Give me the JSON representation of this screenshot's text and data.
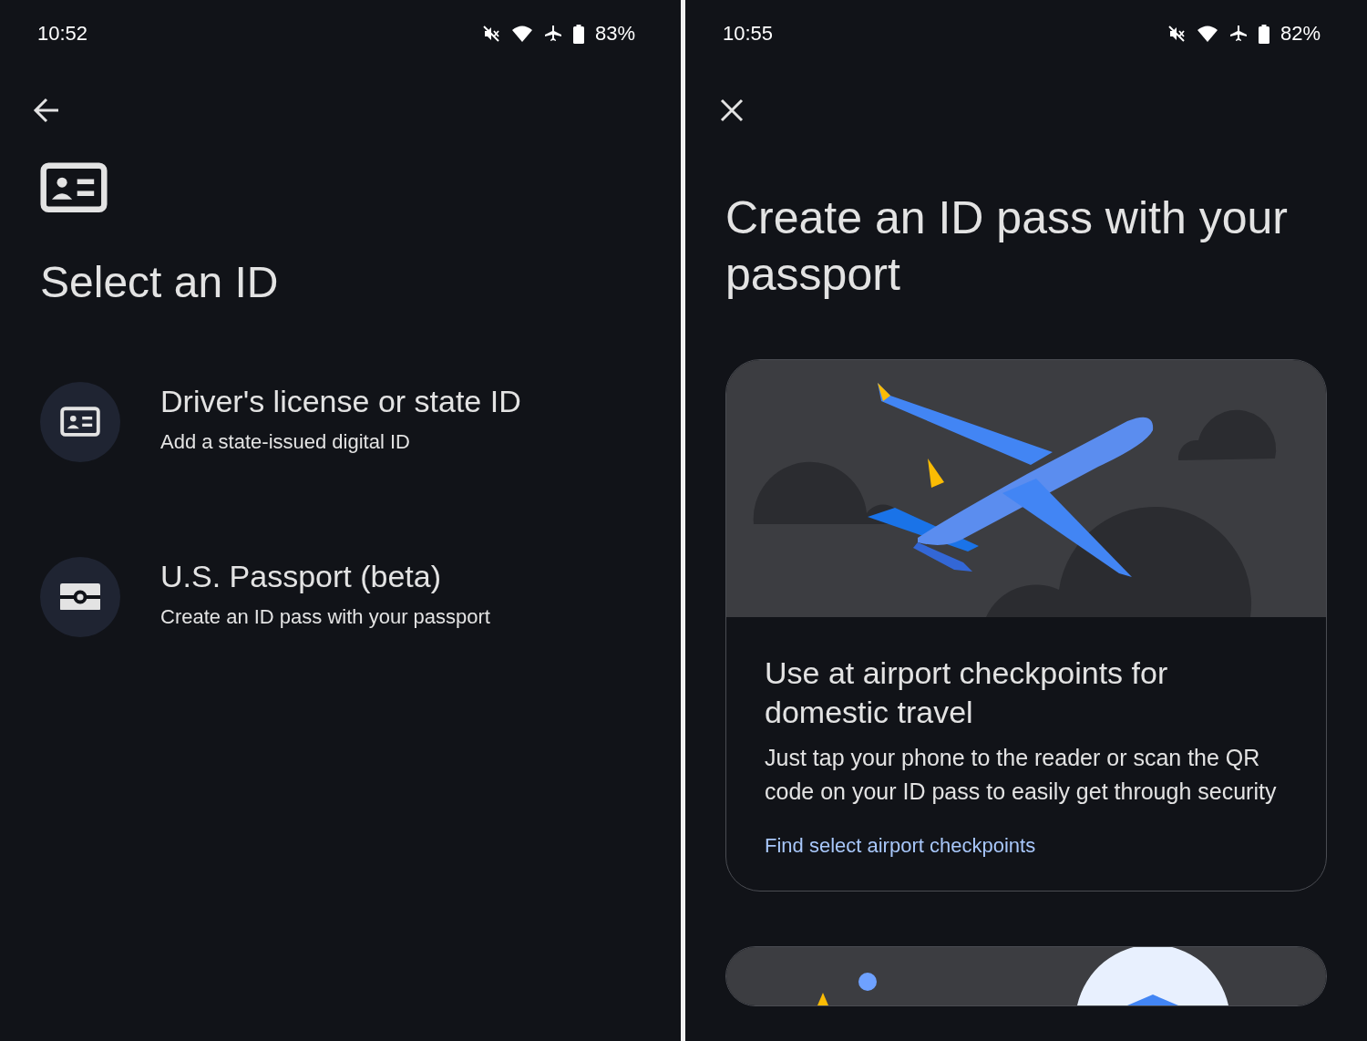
{
  "screens": [
    {
      "status_bar": {
        "time": "10:52",
        "battery": "83%"
      },
      "nav_button": {
        "kind": "back"
      },
      "header_icon": {
        "kind": "id-card"
      },
      "title": "Select an ID",
      "options": [
        {
          "kind": "id-card",
          "title": "Driver's license or state ID",
          "subtitle": "Add a state-issued digital ID"
        },
        {
          "kind": "passport",
          "title": "U.S. Passport (beta)",
          "subtitle": "Create an ID pass with your passport"
        }
      ]
    },
    {
      "status_bar": {
        "time": "10:55",
        "battery": "82%"
      },
      "nav_button": {
        "kind": "close"
      },
      "title": "Create an ID pass with your passport",
      "cards": [
        {
          "kind": "plane",
          "heading": "Use at airport checkpoints for domestic travel",
          "body": "Just tap your phone to the reader or scan the QR code on your ID pass to easily get through security",
          "link": "Find select airport checkpoints"
        },
        {
          "kind": "shield"
        }
      ]
    }
  ]
}
